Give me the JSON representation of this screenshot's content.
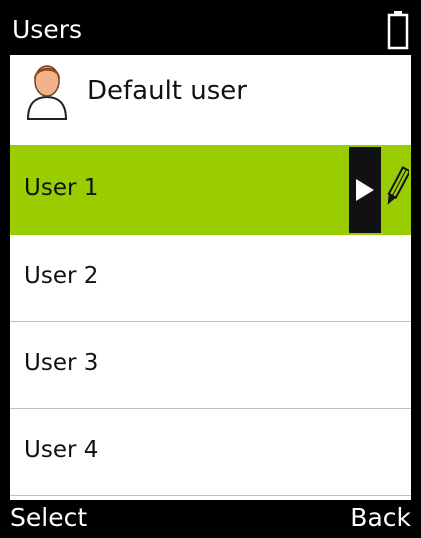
{
  "statusbar": {
    "title": "Users",
    "battery_icon": "battery-icon"
  },
  "current_user": {
    "icon": "user-avatar-icon",
    "name": "Default user"
  },
  "users": {
    "items": [
      {
        "label": "User 1",
        "selected": true
      },
      {
        "label": "User 2",
        "selected": false
      },
      {
        "label": "User 3",
        "selected": false
      },
      {
        "label": "User 4",
        "selected": false
      }
    ],
    "selected_actions": {
      "open_icon": "play-arrow-icon",
      "edit_icon": "pencil-icon"
    }
  },
  "softkeys": {
    "left": "Select",
    "right": "Back"
  },
  "colors": {
    "highlight": "#9acd00",
    "bar": "#000000",
    "background": "#ffffff",
    "divider": "#bfbfbf"
  }
}
